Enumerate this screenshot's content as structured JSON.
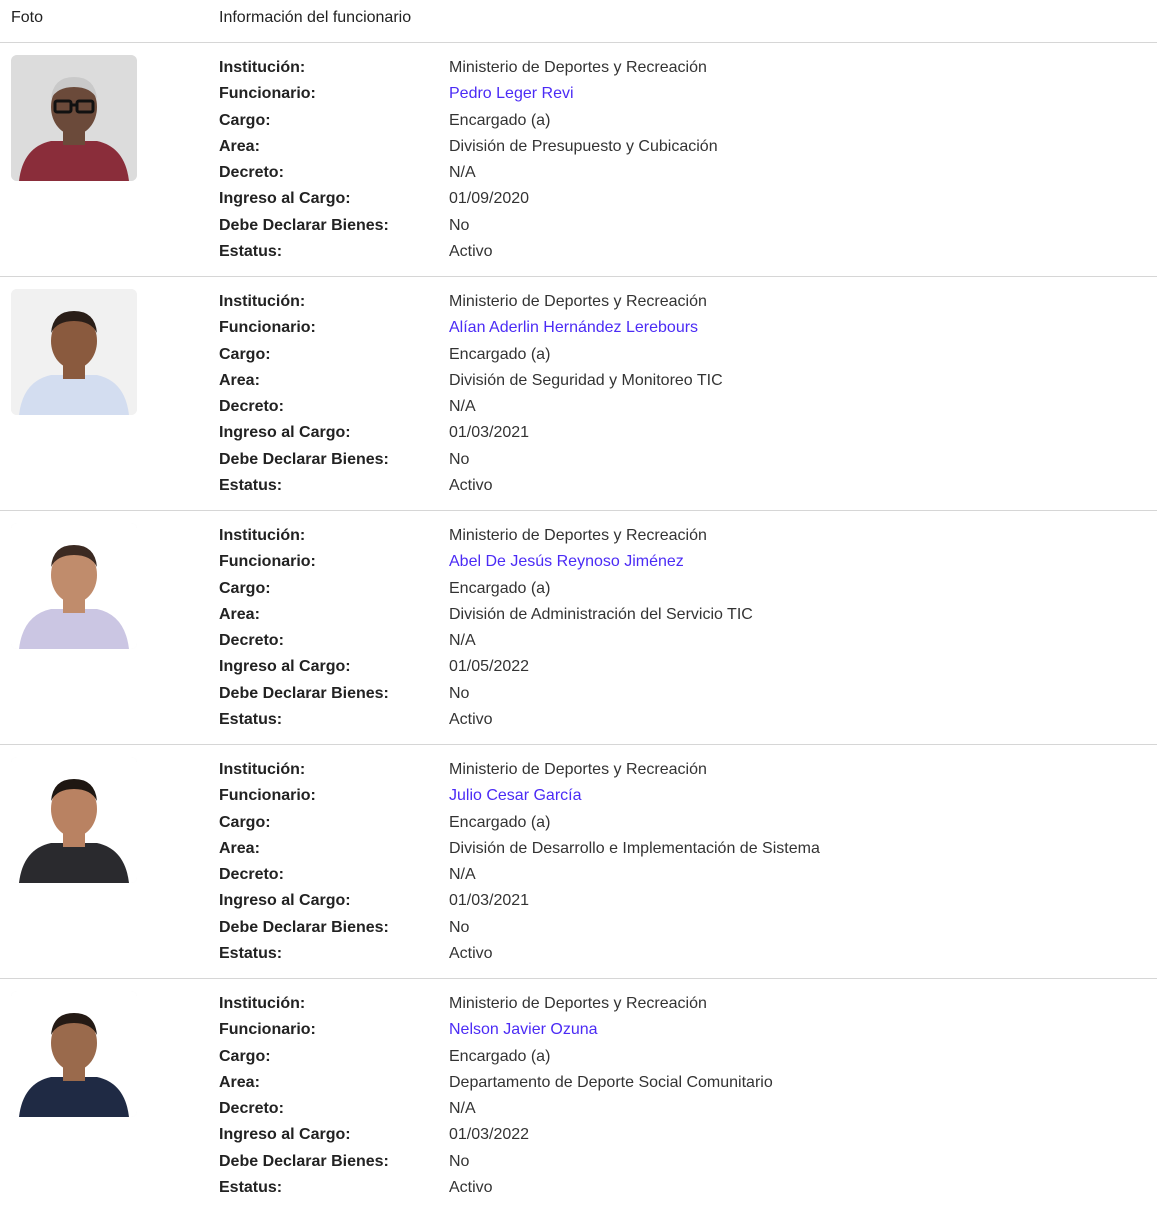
{
  "header": {
    "foto": "Foto",
    "info": "Información del funcionario"
  },
  "labels": {
    "institucion": "Institución:",
    "funcionario": "Funcionario:",
    "cargo": "Cargo:",
    "area": "Area:",
    "decreto": "Decreto:",
    "ingreso": "Ingreso al Cargo:",
    "declarar": "Debe Declarar Bienes:",
    "estatus": "Estatus:"
  },
  "colors": {
    "link": "#4b2bf5",
    "divider": "#d6d6d6"
  },
  "rows": [
    {
      "institucion": "Ministerio de Deportes y Recreación",
      "funcionario": "Pedro Leger Revi",
      "cargo": "Encargado (a)",
      "area": "División de Presupuesto y Cubicación",
      "decreto": "N/A",
      "ingreso": "01/09/2020",
      "declarar": "No",
      "estatus": "Activo",
      "photo": {
        "bg": "#dcdcdc",
        "skin": "#6b4a3a",
        "hair": "#c9c9c9",
        "shirt": "#8a2d3a",
        "glasses": true
      }
    },
    {
      "institucion": "Ministerio de Deportes y Recreación",
      "funcionario": "Alían Aderlin Hernández Lerebours",
      "cargo": "Encargado (a)",
      "area": "División de Seguridad y Monitoreo TIC",
      "decreto": "N/A",
      "ingreso": "01/03/2021",
      "declarar": "No",
      "estatus": "Activo",
      "photo": {
        "bg": "#f1f1f1",
        "skin": "#8a5a3e",
        "hair": "#2a1e18",
        "shirt": "#d3ddf0",
        "glasses": false
      }
    },
    {
      "institucion": "Ministerio de Deportes y Recreación",
      "funcionario": "Abel De Jesús Reynoso Jiménez",
      "cargo": "Encargado (a)",
      "area": "División de Administración del Servicio TIC",
      "decreto": "N/A",
      "ingreso": "01/05/2022",
      "declarar": "No",
      "estatus": "Activo",
      "photo": {
        "bg": "#ffffff",
        "skin": "#c08c6c",
        "hair": "#3b2a22",
        "shirt": "#cbc6e3",
        "glasses": false
      }
    },
    {
      "institucion": "Ministerio de Deportes y Recreación",
      "funcionario": "Julio Cesar García",
      "cargo": "Encargado (a)",
      "area": "División de Desarrollo e Implementación de Sistema",
      "decreto": "N/A",
      "ingreso": "01/03/2021",
      "declarar": "No",
      "estatus": "Activo",
      "photo": {
        "bg": "#ffffff",
        "skin": "#b98262",
        "hair": "#1e1712",
        "shirt": "#2a2a2e",
        "glasses": false
      }
    },
    {
      "institucion": "Ministerio de Deportes y Recreación",
      "funcionario": "Nelson Javier Ozuna",
      "cargo": "Encargado (a)",
      "area": "Departamento de Deporte Social Comunitario",
      "decreto": "N/A",
      "ingreso": "01/03/2022",
      "declarar": "No",
      "estatus": "Activo",
      "photo": {
        "bg": "#ffffff",
        "skin": "#9a6a4c",
        "hair": "#241a14",
        "shirt": "#1f2a44",
        "glasses": false
      }
    }
  ]
}
